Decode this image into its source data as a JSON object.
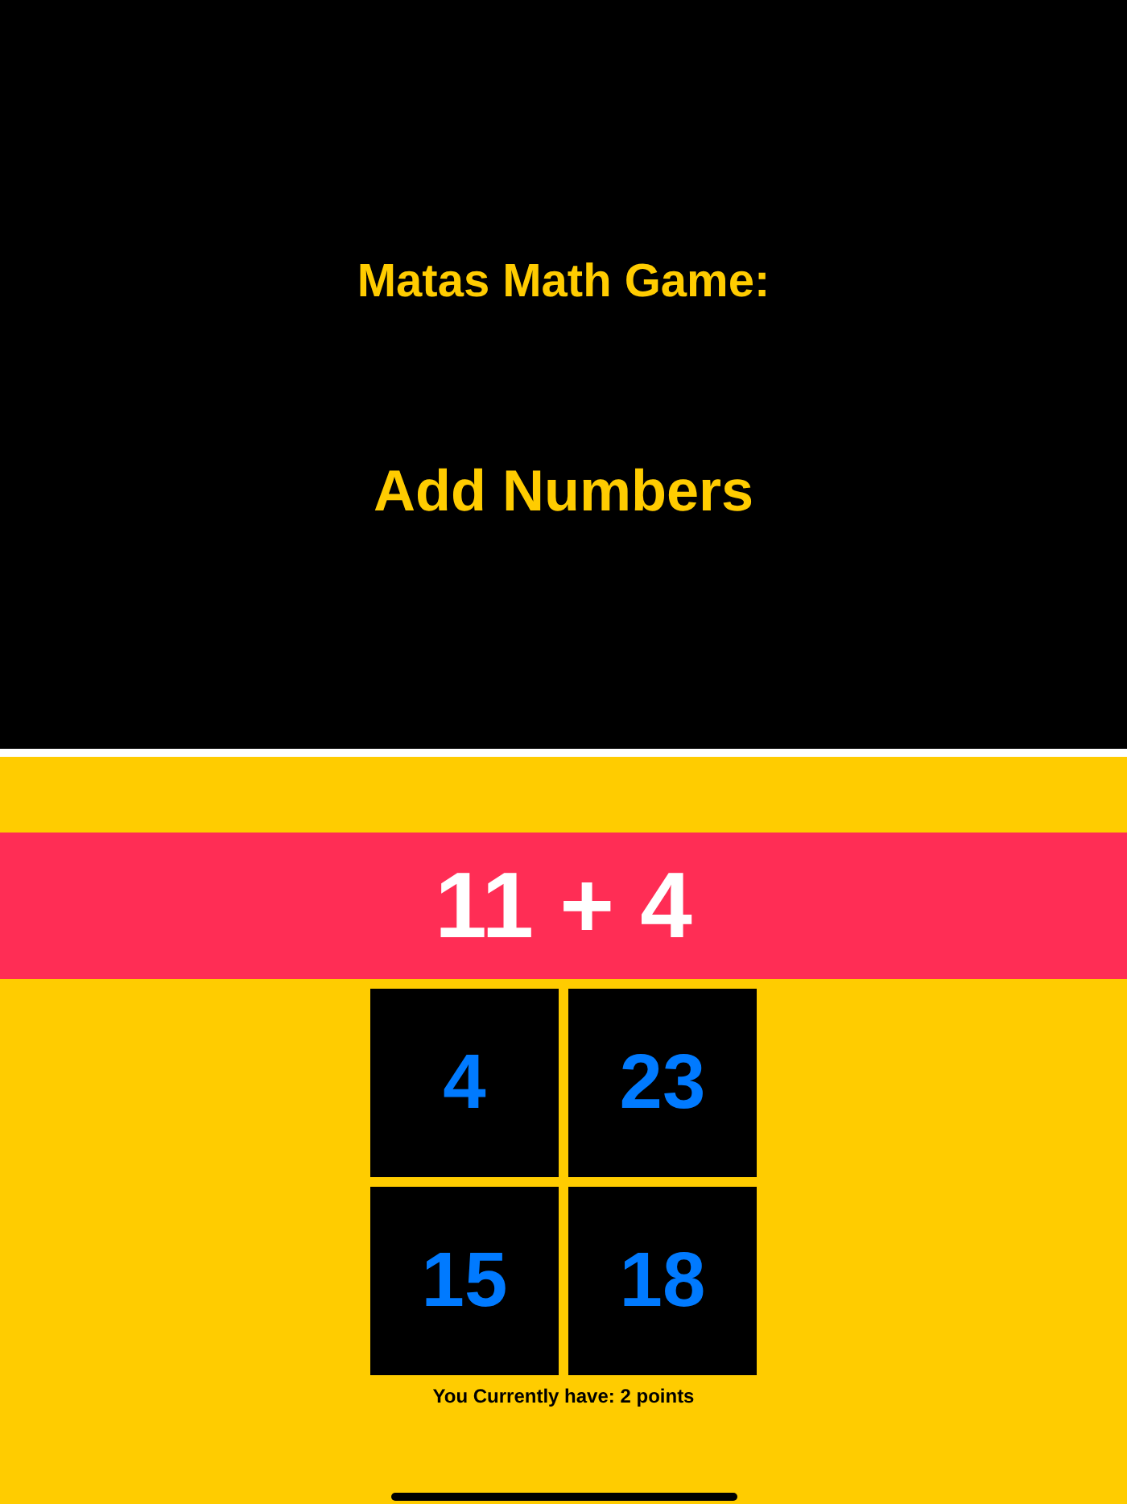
{
  "header": {
    "title": "Matas Math Game:",
    "subtitle": "Add Numbers"
  },
  "question": "11 + 4",
  "answers": [
    {
      "label": "4"
    },
    {
      "label": "23"
    },
    {
      "label": "15"
    },
    {
      "label": "18"
    }
  ],
  "score": "You Currently have: 2 points"
}
